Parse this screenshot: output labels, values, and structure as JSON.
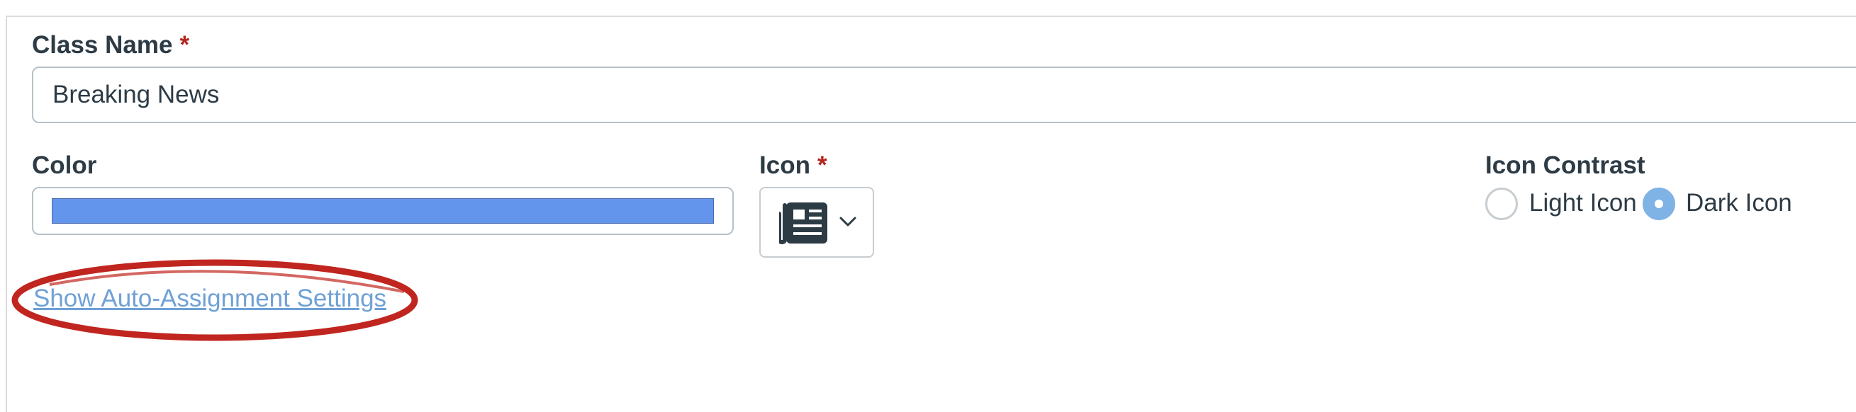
{
  "form": {
    "class_name_label": "Class Name",
    "required_mark": "*",
    "class_name_value": "Breaking News",
    "color_label": "Color",
    "color_value": "#6495ed",
    "icon_label": "Icon",
    "icon_selected": "newspaper-icon",
    "icon_contrast_label": "Icon Contrast",
    "contrast_options": [
      {
        "label": "Light Icon",
        "selected": false
      },
      {
        "label": "Dark Icon",
        "selected": true
      }
    ],
    "auto_assign_link": "Show Auto-Assignment Settings"
  },
  "annotation": {
    "color": "#c0261f",
    "shape": "ellipse"
  }
}
